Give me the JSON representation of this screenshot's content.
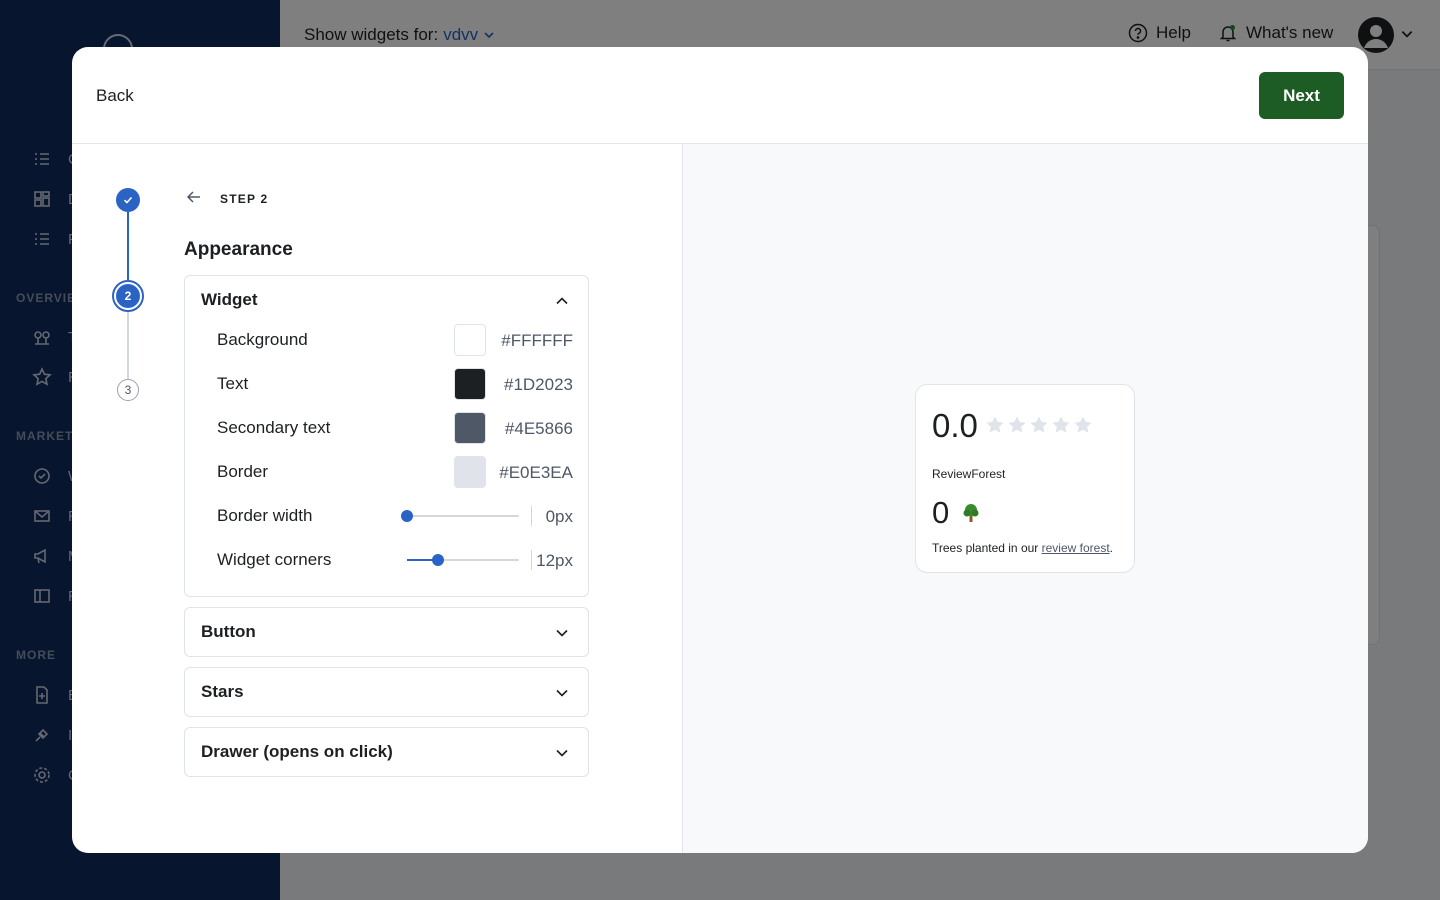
{
  "sidebar": {
    "sections": [
      {
        "label": "OVERVIE"
      },
      {
        "label": "MARKET"
      },
      {
        "label": "MORE"
      }
    ],
    "items": [
      {
        "label": "C",
        "icon": "list-icon"
      },
      {
        "label": "D",
        "icon": "dashboard-icon"
      },
      {
        "label": "P",
        "icon": "list-icon"
      },
      {
        "label": "T",
        "icon": "trees-icon"
      },
      {
        "label": "R",
        "icon": "star-icon"
      },
      {
        "label": "W",
        "icon": "badge-check-icon"
      },
      {
        "label": "R",
        "icon": "mail-icon"
      },
      {
        "label": "M",
        "icon": "megaphone-icon"
      },
      {
        "label": "R",
        "icon": "book-icon"
      },
      {
        "label": "E",
        "icon": "file-plus-icon"
      },
      {
        "label": "I",
        "icon": "plug-icon"
      },
      {
        "label": "C",
        "icon": "gear-icon"
      }
    ]
  },
  "topbar": {
    "show_widgets_label": "Show widgets for:",
    "account_name": "vdvv",
    "help_label": "Help",
    "whats_new_label": "What's new"
  },
  "modal": {
    "back_label": "Back",
    "next_label": "Next",
    "stepper": {
      "current_step_number": "2",
      "next_step_number": "3",
      "step_label": "STEP 2"
    },
    "section_title": "Appearance",
    "widget_panel": {
      "title": "Widget",
      "rows": {
        "background": {
          "label": "Background",
          "value": "#FFFFFF",
          "color": "#FFFFFF"
        },
        "text": {
          "label": "Text",
          "value": "#1D2023",
          "color": "#1D2023"
        },
        "secondary_text": {
          "label": "Secondary text",
          "value": "#4E5866",
          "color": "#4E5866"
        },
        "border": {
          "label": "Border",
          "value": "#E0E3EA",
          "color": "#E0E3EA"
        },
        "border_width": {
          "label": "Border width",
          "value": "0px",
          "slider_fraction": 0.0
        },
        "widget_corners": {
          "label": "Widget corners",
          "value": "12px",
          "slider_fraction": 0.28
        }
      }
    },
    "collapsed_panels": {
      "button": "Button",
      "stars": "Stars",
      "drawer": "Drawer (opens on click)"
    },
    "preview": {
      "rating": "0.0",
      "star_count": 5,
      "brand": "ReviewForest",
      "trees_count": "0",
      "trees_text_prefix": "Trees planted in our",
      "trees_link": "review forest",
      "trees_text_suffix": "."
    }
  },
  "colors": {
    "primary_blue": "#2b63c4",
    "next_button": "#1e5c26",
    "sidebar_bg": "#0f2a5c"
  }
}
